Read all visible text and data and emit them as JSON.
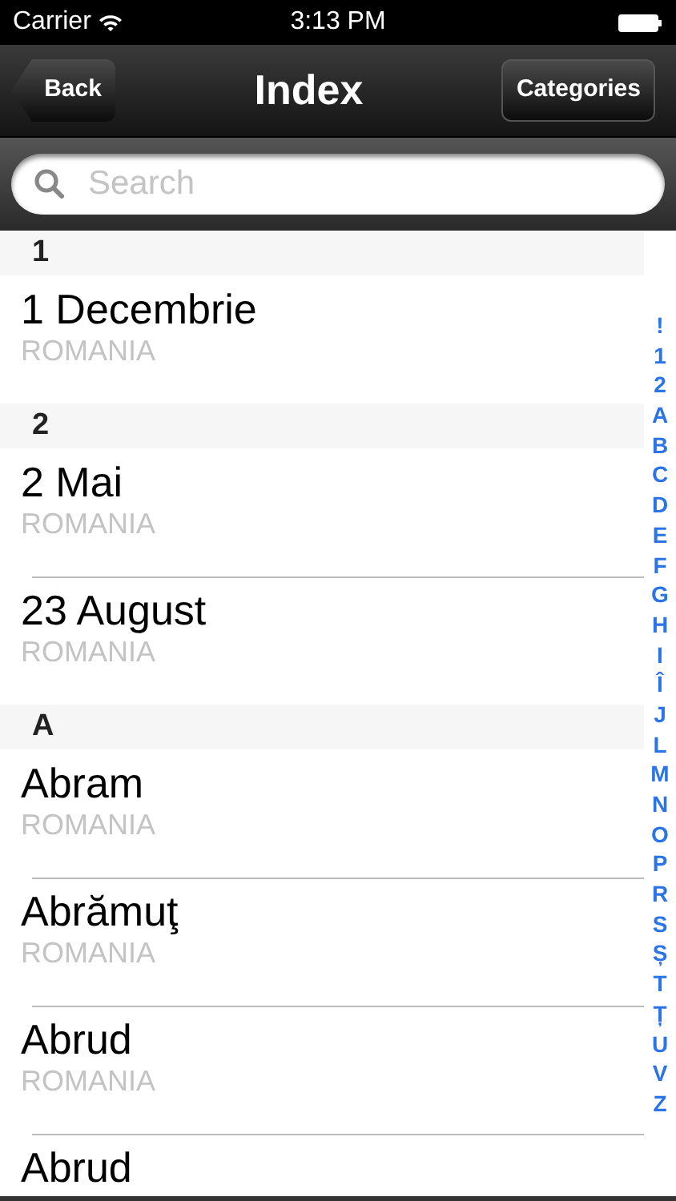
{
  "status_bar": {
    "carrier": "Carrier",
    "time": "3:13 PM"
  },
  "nav_bar": {
    "back": "Back",
    "title": "Index",
    "right_button": "Categories"
  },
  "search": {
    "placeholder": "Search"
  },
  "sections": [
    {
      "header": "1",
      "rows": [
        {
          "title": "1 Decembrie",
          "subtitle": "ROMANIA"
        }
      ]
    },
    {
      "header": "2",
      "rows": [
        {
          "title": "2 Mai",
          "subtitle": "ROMANIA"
        },
        {
          "title": "23 August",
          "subtitle": "ROMANIA"
        }
      ]
    },
    {
      "header": "A",
      "rows": [
        {
          "title": "Abram",
          "subtitle": "ROMANIA"
        },
        {
          "title": "Abrămuţ",
          "subtitle": "ROMANIA"
        },
        {
          "title": "Abrud",
          "subtitle": "ROMANIA"
        },
        {
          "title": "Abrud"
        }
      ]
    }
  ],
  "index_letters": [
    "!",
    "1",
    "2",
    "A",
    "B",
    "C",
    "D",
    "E",
    "F",
    "G",
    "H",
    "I",
    "Î",
    "J",
    "L",
    "M",
    "N",
    "O",
    "P",
    "R",
    "S",
    "Ș",
    "T",
    "Ț",
    "U",
    "V",
    "Z"
  ]
}
